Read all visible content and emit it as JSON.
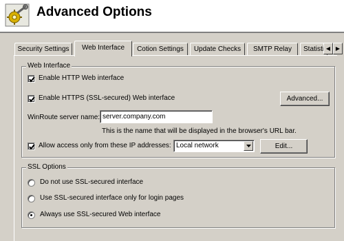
{
  "header": {
    "title": "Advanced Options",
    "icon": "gear-wrench-icon"
  },
  "tabs": [
    {
      "label": "Security Settings",
      "active": false
    },
    {
      "label": "Web Interface",
      "active": true
    },
    {
      "label": "Cotion Settings",
      "active": false
    },
    {
      "label": "Update Checks",
      "active": false
    },
    {
      "label": "SMTP Relay",
      "active": false
    },
    {
      "label": "Statisti",
      "active": false
    }
  ],
  "web_interface": {
    "group_label": "Web Interface",
    "enable_http": {
      "label": "Enable HTTP Web interface",
      "checked": true
    },
    "enable_https": {
      "label": "Enable HTTPS (SSL-secured) Web interface",
      "checked": true
    },
    "advanced_button": "Advanced...",
    "server_name_label": "WinRoute server name:",
    "server_name_value": "server.company.com",
    "server_name_hint": "This is the name that will be displayed in the browser's URL bar.",
    "allow_access": {
      "label": "Allow access only from these IP addresses:",
      "checked": true
    },
    "ip_group_selected": "Local network",
    "edit_button": "Edit..."
  },
  "ssl_options": {
    "group_label": "SSL Options",
    "options": [
      {
        "label": "Do not use SSL-secured interface",
        "selected": false
      },
      {
        "label": "Use SSL-secured interface only for login pages",
        "selected": false
      },
      {
        "label": "Always use SSL-secured Web interface",
        "selected": true
      }
    ]
  }
}
